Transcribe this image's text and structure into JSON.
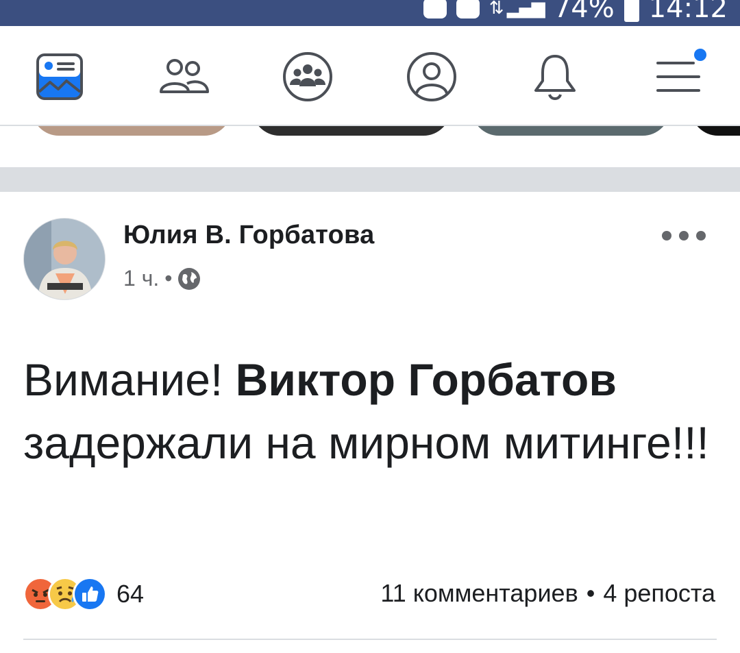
{
  "status_bar": {
    "battery": "74%",
    "time": "14:12"
  },
  "nav": {
    "items": [
      {
        "name": "news-feed",
        "icon": "news-feed-icon",
        "active": true
      },
      {
        "name": "friends",
        "icon": "friends-icon"
      },
      {
        "name": "groups",
        "icon": "groups-icon"
      },
      {
        "name": "profile",
        "icon": "profile-icon"
      },
      {
        "name": "notifications",
        "icon": "bell-icon"
      },
      {
        "name": "menu",
        "icon": "menu-icon",
        "badge": true
      }
    ],
    "colors": {
      "active": "#1877f2",
      "inactive": "#4b4f56",
      "background": "#3b4f80"
    }
  },
  "post": {
    "author": "Юлия В. Горбатова",
    "time": "1 ч.",
    "separator": "•",
    "privacy_icon": "globe-icon",
    "text_part1": "Вимание! ",
    "text_bold": "Виктор Горбатов",
    "text_part2": " задержали на мирном митинге!!!",
    "reactions": [
      "angry-reaction-icon",
      "sad-reaction-icon",
      "like-reaction-icon"
    ],
    "reaction_count": "64",
    "comments": "11 комментариев",
    "stats_separator": "•",
    "shares": "4 репоста"
  }
}
